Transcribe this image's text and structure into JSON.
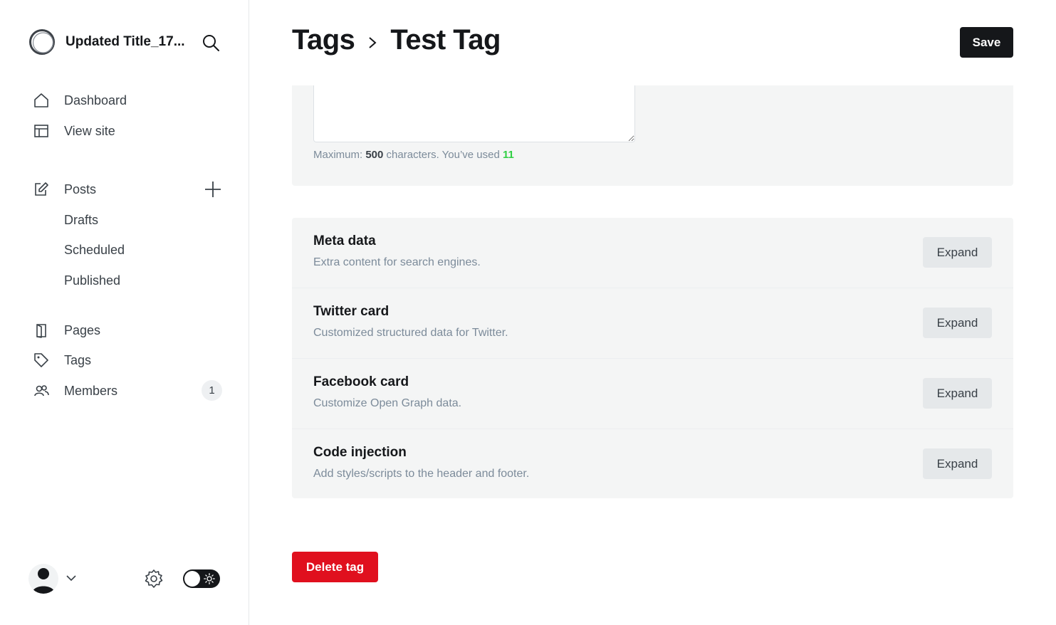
{
  "sidebar": {
    "site_title": "Updated Title_17...",
    "nav": {
      "dashboard": "Dashboard",
      "view_site": "View site",
      "posts": "Posts",
      "drafts": "Drafts",
      "scheduled": "Scheduled",
      "published": "Published",
      "pages": "Pages",
      "tags": "Tags",
      "members": "Members",
      "members_count": "1"
    }
  },
  "header": {
    "breadcrumb_parent": "Tags",
    "breadcrumb_current": "Test Tag",
    "save_label": "Save"
  },
  "description": {
    "hint_prefix": "Maximum:",
    "max_chars": "500",
    "hint_middle": "characters. You’ve used",
    "used_chars": "11",
    "used_color": "#30cf43"
  },
  "settings_sections": [
    {
      "title": "Meta data",
      "description": "Extra content for search engines.",
      "button": "Expand"
    },
    {
      "title": "Twitter card",
      "description": "Customized structured data for Twitter.",
      "button": "Expand"
    },
    {
      "title": "Facebook card",
      "description": "Customize Open Graph data.",
      "button": "Expand"
    },
    {
      "title": "Code injection",
      "description": "Add styles/scripts to the header and footer.",
      "button": "Expand"
    }
  ],
  "delete_label": "Delete tag",
  "colors": {
    "primary_dark": "#15171a",
    "danger": "#e0101e",
    "panel_bg": "#f4f5f5",
    "muted_text": "#7c8b9a"
  },
  "icons": {
    "logo": "site-logo-ring",
    "search": "search-icon",
    "dashboard": "home-icon",
    "view_site": "layout-icon",
    "posts": "edit-icon",
    "add_post": "plus-icon",
    "pages": "pages-icon",
    "tags": "tag-icon",
    "members": "members-icon",
    "settings": "gear-icon",
    "theme": "sun-icon"
  }
}
